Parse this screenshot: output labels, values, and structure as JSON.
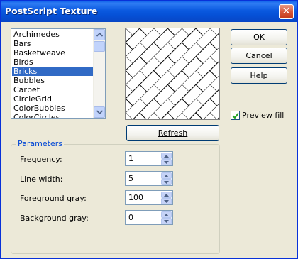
{
  "dialog": {
    "title": "PostScript Texture",
    "close_glyph": "✕"
  },
  "texture_list": {
    "items": [
      "Archimedes",
      "Bars",
      "Basketweave",
      "Birds",
      "Bricks",
      "Bubbles",
      "Carpet",
      "CircleGrid",
      "ColorBubbles",
      "ColorCircles"
    ],
    "selected": "Bricks"
  },
  "buttons": {
    "ok": "OK",
    "cancel": "Cancel",
    "help": "Help",
    "refresh": "Refresh"
  },
  "preview_fill": {
    "label": "Preview fill",
    "checked": true
  },
  "parameters": {
    "title": "Parameters",
    "fields": [
      {
        "label": "Frequency:",
        "value": "1"
      },
      {
        "label": "Line width:",
        "value": "5"
      },
      {
        "label": "Foreground gray:",
        "value": "100"
      },
      {
        "label": "Background gray:",
        "value": "0"
      }
    ]
  },
  "colors": {
    "title_bar": "#0a5fe8",
    "selection": "#316ac5",
    "group_title": "#0046d5",
    "dialog_bg": "#ece9d8"
  }
}
